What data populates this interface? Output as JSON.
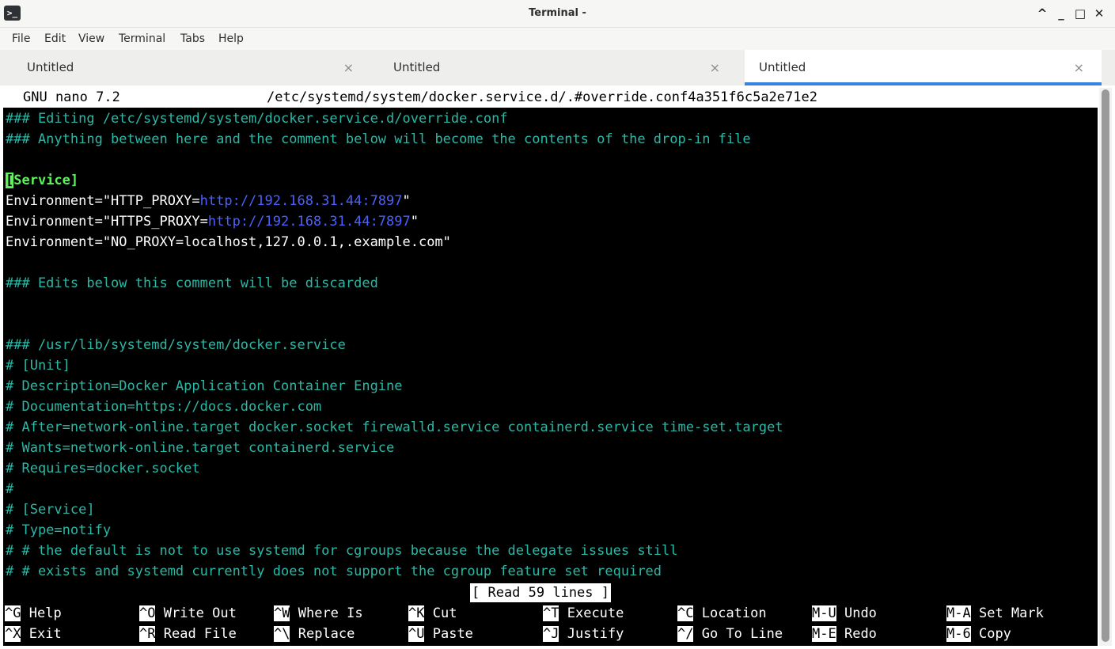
{
  "window": {
    "title": "Terminal -",
    "icon": "terminal-icon",
    "controls": [
      "chevron-up-icon",
      "minimize-icon",
      "maximize-icon",
      "close-icon"
    ]
  },
  "menu": [
    "File",
    "Edit",
    "View",
    "Terminal",
    "Tabs",
    "Help"
  ],
  "tabs": [
    {
      "label": "Untitled",
      "close": "×"
    },
    {
      "label": "Untitled",
      "close": "×"
    },
    {
      "label": "Untitled",
      "close": "×"
    }
  ],
  "nano": {
    "version": "GNU nano 7.2",
    "filename": "/etc/systemd/system/docker.service.d/.#override.conf4a351f6c5a2e71e2"
  },
  "lines": {
    "l1": "### Editing /etc/systemd/system/docker.service.d/override.conf",
    "l2": "### Anything between here and the comment below will become the contents of the drop-in file",
    "l4_cursor": "[",
    "l4_rest": "Service]",
    "l5_key": "Environment=\"HTTP_PROXY=",
    "l5_url": "http://192.168.31.44:7897",
    "l5_end": "\"",
    "l6_key": "Environment=\"HTTPS_PROXY=",
    "l6_url": "http://192.168.31.44:7897",
    "l6_end": "\"",
    "l7": "Environment=\"NO_PROXY=localhost,127.0.0.1,.example.com\"",
    "l9": "### Edits below this comment will be discarded",
    "l12": "### /usr/lib/systemd/system/docker.service",
    "l13": "# [Unit]",
    "l14": "# Description=Docker Application Container Engine",
    "l15": "# Documentation=https://docs.docker.com",
    "l16": "# After=network-online.target docker.socket firewalld.service containerd.service time-set.target",
    "l17": "# Wants=network-online.target containerd.service",
    "l18": "# Requires=docker.socket",
    "l19": "#",
    "l20": "# [Service]",
    "l21": "# Type=notify",
    "l22": "# # the default is not to use systemd for cgroups because the delegate issues still",
    "l23": "# # exists and systemd currently does not support the cgroup feature set required"
  },
  "message": "[ Read 59 lines ]",
  "shortcuts": [
    {
      "key": "^G",
      "label": "Help"
    },
    {
      "key": "^O",
      "label": "Write Out"
    },
    {
      "key": "^W",
      "label": "Where Is"
    },
    {
      "key": "^K",
      "label": "Cut"
    },
    {
      "key": "^T",
      "label": "Execute"
    },
    {
      "key": "^C",
      "label": "Location"
    },
    {
      "key": "M-U",
      "label": "Undo"
    },
    {
      "key": "M-A",
      "label": "Set Mark"
    },
    {
      "key": "^X",
      "label": "Exit"
    },
    {
      "key": "^R",
      "label": "Read File"
    },
    {
      "key": "^\\",
      "label": "Replace"
    },
    {
      "key": "^U",
      "label": "Paste"
    },
    {
      "key": "^J",
      "label": "Justify"
    },
    {
      "key": "^/",
      "label": "Go To Line"
    },
    {
      "key": "M-E",
      "label": "Redo"
    },
    {
      "key": "M-6",
      "label": "Copy"
    }
  ],
  "colors": {
    "comment": "#2bb8a6",
    "url": "#4b60ff",
    "section": "#5cf35c",
    "tab_accent": "#3584e4"
  }
}
